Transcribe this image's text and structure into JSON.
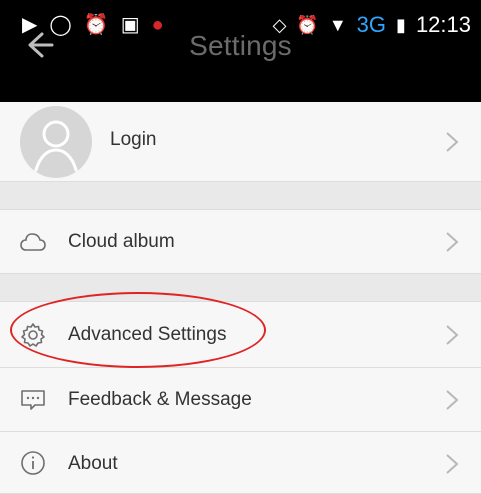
{
  "header": {
    "title": "Settings",
    "time": "12:13",
    "network": "3G"
  },
  "rows": {
    "login": "Login",
    "cloud_album": "Cloud album",
    "advanced_settings": "Advanced Settings",
    "feedback": "Feedback & Message",
    "about": "About"
  },
  "icons": {
    "back": "back-arrow-icon",
    "avatar": "user-avatar-icon",
    "cloud": "cloud-icon",
    "gear": "gear-icon",
    "feedback": "chat-bubble-icon",
    "about": "info-icon",
    "chevron": "chevron-right-icon"
  },
  "colors": {
    "accent": "#2ea6ff",
    "highlight": "#e02424"
  }
}
